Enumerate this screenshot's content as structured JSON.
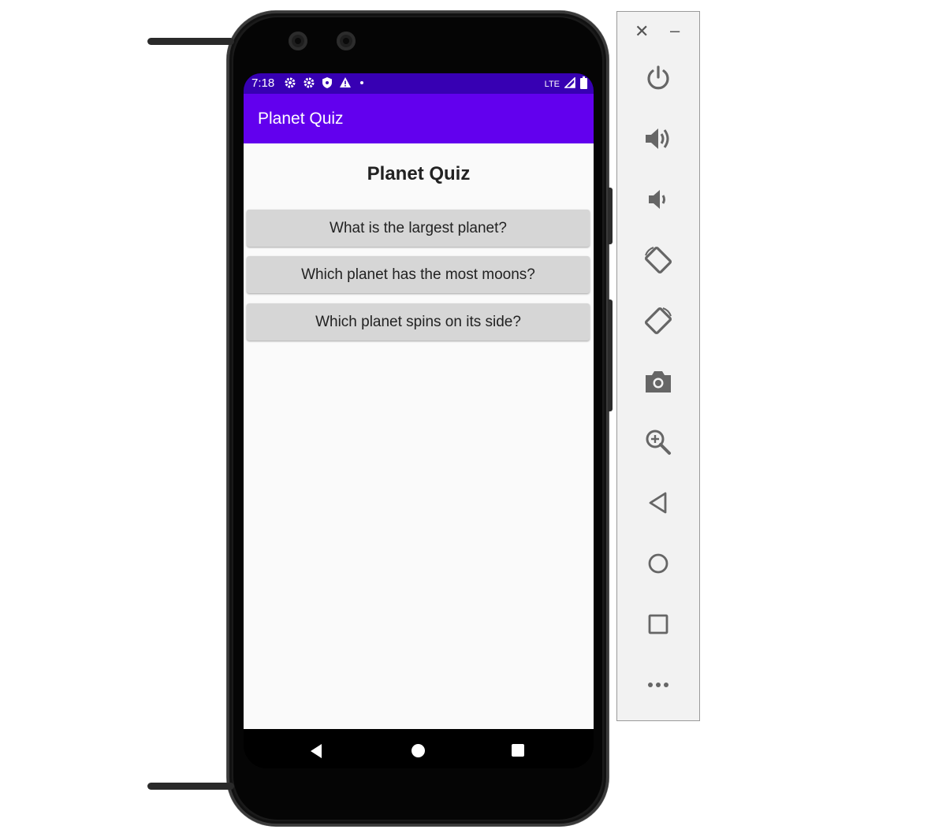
{
  "status_bar": {
    "time": "7:18",
    "network": "LTE",
    "icons": [
      "settings-icon",
      "settings-icon",
      "shield-icon",
      "warning-icon",
      "dot-icon",
      "signal-icon",
      "battery-icon"
    ]
  },
  "app_bar": {
    "title": "Planet Quiz"
  },
  "main": {
    "heading": "Planet Quiz",
    "questions": [
      {
        "label": "What is the largest planet?"
      },
      {
        "label": "Which planet has the most moons?"
      },
      {
        "label": "Which planet spins on its side?"
      }
    ]
  },
  "emulator_panel": {
    "close_label": "✕",
    "minimize_label": "–",
    "controls": [
      "power-icon",
      "volume-up-icon",
      "volume-down-icon",
      "rotate-left-icon",
      "rotate-right-icon",
      "camera-icon",
      "zoom-icon",
      "back-icon",
      "home-icon",
      "overview-icon",
      "more-icon"
    ]
  },
  "colors": {
    "status_bar": "#3700b3",
    "app_bar": "#6200ee",
    "content_bg": "#fafafa",
    "button_bg": "#d6d6d6",
    "panel_bg": "#f2f2f2"
  }
}
